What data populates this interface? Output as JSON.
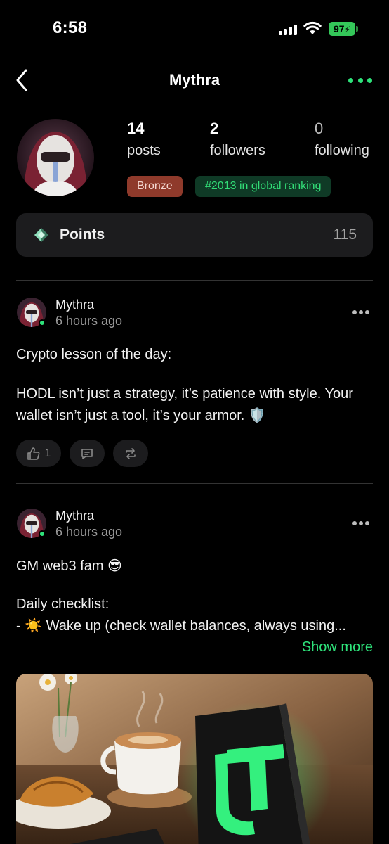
{
  "status_bar": {
    "time": "6:58",
    "battery": "97"
  },
  "header": {
    "title": "Mythra"
  },
  "profile": {
    "stats": [
      {
        "value": "14",
        "label": "posts"
      },
      {
        "value": "2",
        "label": "followers"
      },
      {
        "value": "0",
        "label": "following"
      }
    ],
    "badge_tier": "Bronze",
    "badge_rank": "#2013 in global ranking",
    "points_label": "Points",
    "points_value": "115"
  },
  "posts": [
    {
      "author": "Mythra",
      "time": "6 hours ago",
      "lines": [
        "Crypto lesson of the day:",
        "HODL isn’t just a strategy, it’s patience with style. Your",
        "wallet isn’t just a tool, it’s your armor. 🛡️"
      ],
      "like_count": "1"
    },
    {
      "author": "Mythra",
      "time": "6 hours ago",
      "lines": [
        "GM web3 fam 😎",
        "Daily checklist:",
        "- ☀️ Wake up (check wallet balances, always using..."
      ],
      "show_more": "Show more"
    }
  ],
  "colors": {
    "accent": "#2ee27a",
    "bronze": "#8f3a2b",
    "card": "#1c1c1e"
  },
  "icons": [
    "back-icon",
    "more-icon",
    "points-gem-icon",
    "like-icon",
    "comment-icon",
    "repost-icon"
  ]
}
